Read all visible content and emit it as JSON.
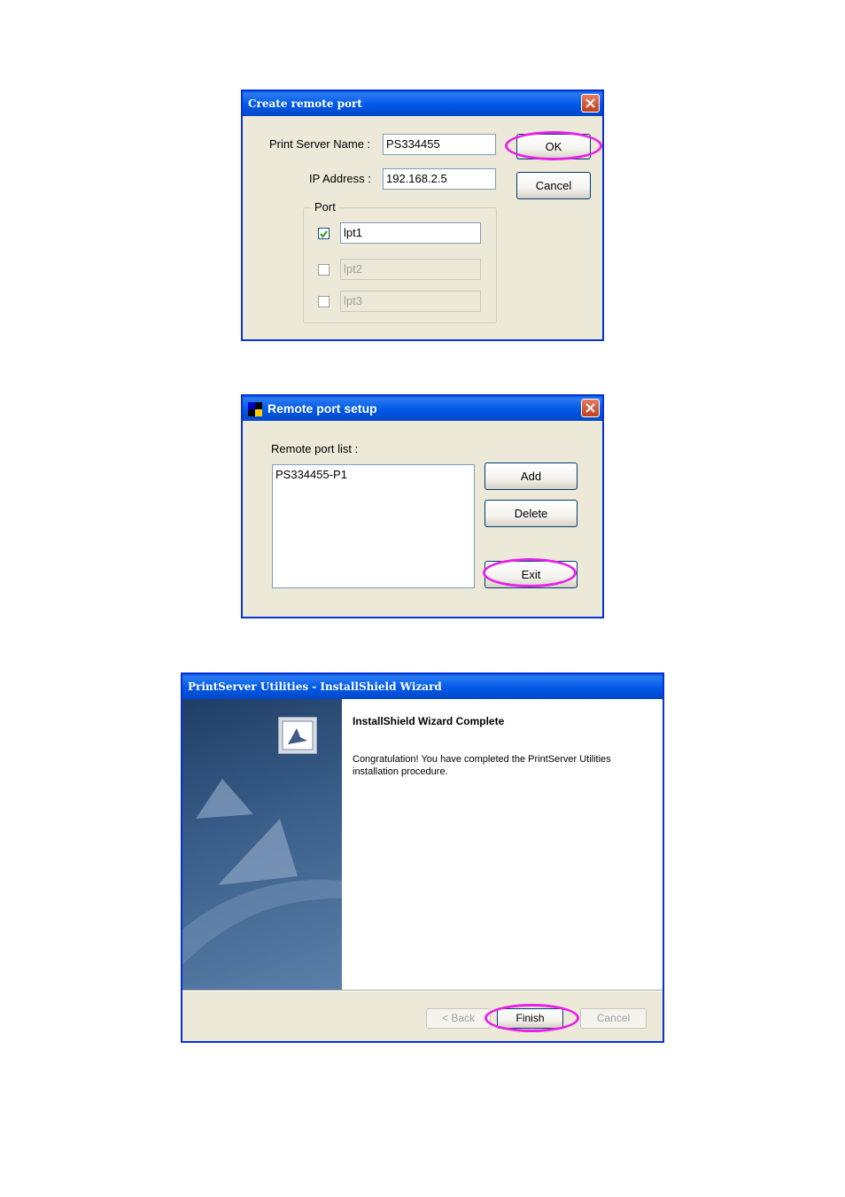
{
  "dialog1": {
    "title": "Create remote port",
    "server_name_label": "Print Server Name :",
    "server_name_value": "PS334455",
    "ip_label": "IP Address :",
    "ip_value": "192.168.2.5",
    "ok_label": "OK",
    "cancel_label": "Cancel",
    "port_group_label": "Port",
    "ports": [
      {
        "checked": true,
        "value": "lpt1",
        "enabled": true
      },
      {
        "checked": false,
        "value": "lpt2",
        "enabled": false
      },
      {
        "checked": false,
        "value": "lpt3",
        "enabled": false
      }
    ]
  },
  "dialog2": {
    "title": "Remote port setup",
    "list_label": "Remote port list :",
    "list_items": [
      "PS334455-P1"
    ],
    "add_label": "Add",
    "delete_label": "Delete",
    "exit_label": "Exit"
  },
  "dialog3": {
    "title": "PrintServer Utilities - InstallShield Wizard",
    "heading": "InstallShield Wizard Complete",
    "message": "Congratulation! You have completed the PrintServer Utilities installation procedure.",
    "back_label": "< Back",
    "finish_label": "Finish",
    "cancel_label": "Cancel"
  },
  "colors": {
    "highlight_circle": "#e622e6",
    "titlebar_blue": "#0058e6",
    "dialog_bg": "#ece9d8"
  }
}
